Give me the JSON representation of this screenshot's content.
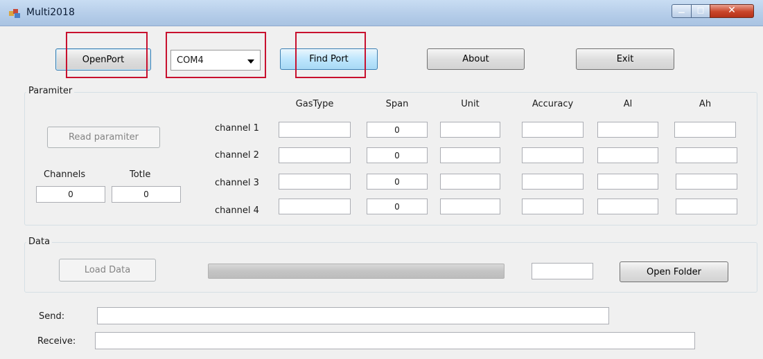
{
  "window": {
    "title": "Multi2018"
  },
  "toolbar": {
    "open_port": "OpenPort",
    "port_selected": "COM4",
    "find_port": "Find Port",
    "about": "About",
    "exit": "Exit"
  },
  "parameter": {
    "group_label": "Paramiter",
    "read_button": "Read paramiter",
    "channels_label": "Channels",
    "totle_label": "Totle",
    "channels_value": "0",
    "totle_value": "0",
    "columns": [
      "GasType",
      "Span",
      "Unit",
      "Accuracy",
      "Al",
      "Ah"
    ],
    "rows": [
      {
        "label": "channel 1",
        "span": "0"
      },
      {
        "label": "channel 2",
        "span": "0"
      },
      {
        "label": "channel 3",
        "span": "0"
      },
      {
        "label": "channel 4",
        "span": "0"
      }
    ]
  },
  "data": {
    "group_label": "Data",
    "load_button": "Load Data",
    "progress": 0,
    "open_folder": "Open Folder"
  },
  "io": {
    "send_label": "Send:",
    "receive_label": "Receive:",
    "send_value": "",
    "receive_value": ""
  },
  "colors": {
    "highlight_box": "#c8102e",
    "window_bg": "#f0f0f0"
  }
}
